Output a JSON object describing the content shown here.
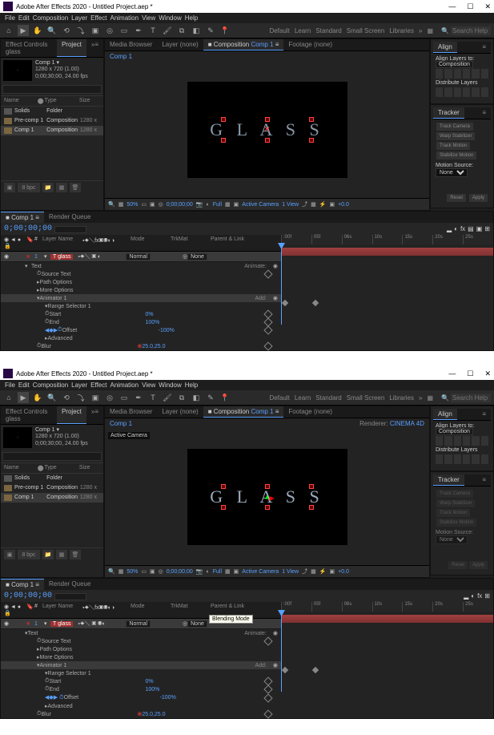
{
  "title": "Adobe After Effects 2020 - Untitled Project.aep *",
  "menu": [
    "File",
    "Edit",
    "Composition",
    "Layer",
    "Effect",
    "Animation",
    "View",
    "Window",
    "Help"
  ],
  "workspace_tabs": [
    "Default",
    "Learn",
    "Standard",
    "Small Screen",
    "Libraries"
  ],
  "search_help_placeholder": "Search Help",
  "project_panel": {
    "tab_effects": "Effect Controls glass",
    "tab_project": "Project",
    "selected_name": "Comp 1 ▾",
    "info_line1": "1280 x 720 (1.00)",
    "info_line2": "0;00;30;00, 24.00 fps",
    "search_placeholder": "",
    "head_name": "Name",
    "head_type": "Type",
    "head_size": "Size",
    "items": [
      {
        "name": "Solids",
        "type": "Folder",
        "size": ""
      },
      {
        "name": "Pre-comp 1",
        "type": "Composition",
        "size": "1280 x"
      },
      {
        "name": "Comp 1",
        "type": "Composition",
        "size": "1280 x"
      }
    ],
    "footer_bpc": "8 bpc"
  },
  "viewer": {
    "tab_browser": "Media Browser",
    "tab_layer": "Layer (none)",
    "tab_comp_prefix": "Composition",
    "tab_comp": "Comp 1",
    "tab_footage": "Footage (none)",
    "breadcrumb": "Comp 1",
    "renderer_label": "Renderer:",
    "renderer_value": "CINEMA 4D",
    "active_camera_badge": "Active Camera",
    "glass_text": "G L A S S",
    "zoom": "50%",
    "timecode": "0;00;00;00",
    "res": "Full",
    "view_label": "Active Camera",
    "one_view": "1 View",
    "adj_btn": "+0.0"
  },
  "align": {
    "title": "Align",
    "layers_to_label": "Align Layers to:",
    "layers_to_value": "Composition",
    "distribute": "Distribute Layers"
  },
  "tracker": {
    "title": "Tracker",
    "track_camera": "Track Camera",
    "warp": "Warp Stabilizer",
    "track_motion": "Track Motion",
    "stabilize": "Stabilize Motion",
    "source_label": "Motion Source:",
    "source_value": "None",
    "apply": "Apply",
    "reset": "Reset"
  },
  "timeline": {
    "tab_comp": "Comp 1",
    "tab_rq": "Render Queue",
    "timecode": "0;00;00;00",
    "search_placeholder": "",
    "head_layer": "Layer Name",
    "head_mode": "Mode",
    "head_trkmat": "TrkMat",
    "head_parent": "Parent & Link",
    "mode_normal": "Normal",
    "parent_none": "None",
    "tooltip_blending": "Blending Mode",
    "ruler": [
      ":00f",
      "05f",
      "06s",
      "10s",
      "15s",
      "20s",
      "25s"
    ],
    "layer_num": "1",
    "layer_name": "glass",
    "prop_text": "Text",
    "prop_animate": "Animate:",
    "prop_source": "Source Text",
    "prop_path": "Path Options",
    "prop_more": "More Options",
    "prop_animator": "Animator 1",
    "prop_add": "Add:",
    "prop_range": "Range Selector 1",
    "prop_start": "Start",
    "prop_start_v": "0%",
    "prop_end": "End",
    "prop_end_v": "100%",
    "prop_offset": "Offset",
    "prop_offset_v": "-100%",
    "prop_advanced": "Advanced",
    "prop_blur": "Blur",
    "prop_blur_v": "25.0,25.0"
  }
}
